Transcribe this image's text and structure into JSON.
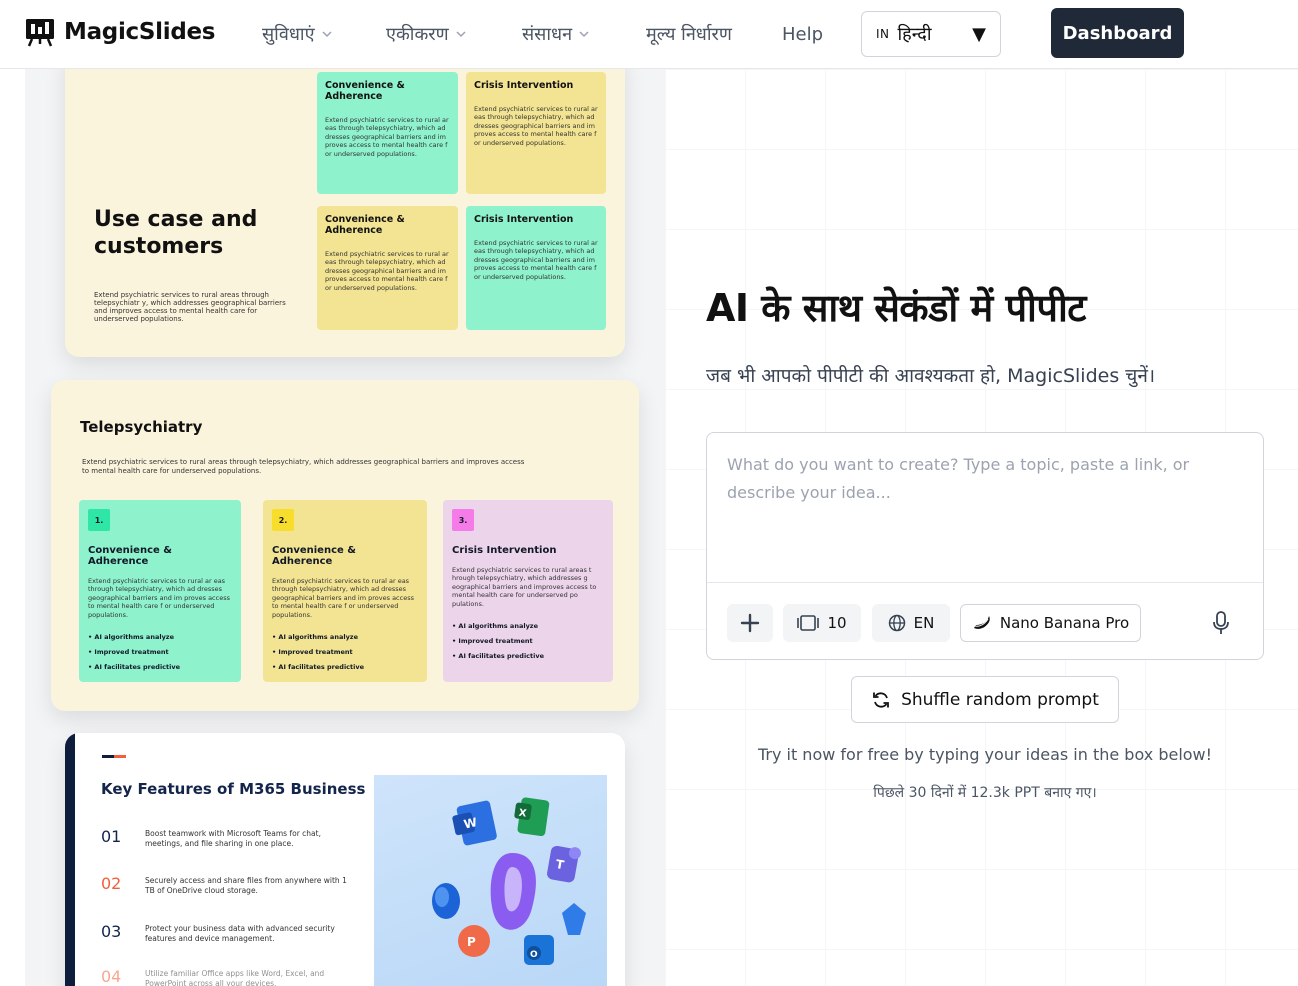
{
  "nav": {
    "logo_text": "MagicSlides",
    "items": [
      {
        "label": "सुविधाएं",
        "has_dropdown": true
      },
      {
        "label": "एकीकरण",
        "has_dropdown": true
      },
      {
        "label": "संसाधन",
        "has_dropdown": true
      },
      {
        "label": "मूल्य निर्धारण",
        "has_dropdown": false
      },
      {
        "label": "Help",
        "has_dropdown": false
      }
    ],
    "language": {
      "code": "IN",
      "label": "हिन्दी"
    },
    "dashboard_label": "Dashboard"
  },
  "slides": {
    "s1": {
      "title": "Use case and customers",
      "desc": "Extend psychiatric services to rural areas through telepsychiatr y, which addresses geographical barriers and improves access to mental health care for underserved populations.",
      "cards": [
        {
          "title": "Convenience & Adherence",
          "text": "Extend psychiatric services to rural ar eas through telepsychiatry, which ad dresses geographical barriers and im proves access to mental health care f or underserved populations.",
          "color": "#8ef2cd"
        },
        {
          "title": "Crisis Intervention",
          "text": "Extend psychiatric services to rural ar eas through telepsychiatry, which ad dresses geographical barriers and im proves access to mental health care f or underserved populations.",
          "color": "#f2e492"
        },
        {
          "title": "Convenience & Adherence",
          "text": "Extend psychiatric services to rural ar eas through telepsychiatry, which ad dresses geographical barriers and im proves access to mental health care f or underserved populations.",
          "color": "#f2e492"
        },
        {
          "title": "Crisis Intervention",
          "text": "Extend psychiatric services to rural ar eas through telepsychiatry, which ad dresses geographical barriers and im proves access to mental health care f or underserved populations.",
          "color": "#8ef2cd"
        }
      ]
    },
    "s2": {
      "title": "Telepsychiatry",
      "desc": "Extend psychiatric services to rural areas through telepsychiatry, which addresses geographical barriers and improves access to mental health care for underserved populations.",
      "columns": [
        {
          "num": "1.",
          "title": "Convenience & Adherence",
          "text": "Extend psychiatric services to rural ar eas through telepsychiatry, which ad dresses geographical barriers and im proves access to mental health care f or underserved populations.",
          "bullets": [
            "• AI algorithms analyze",
            "• Improved treatment",
            "• AI facilitates predictive"
          ]
        },
        {
          "num": "2.",
          "title": "Convenience & Adherence",
          "text": "Extend psychiatric services to rural ar eas through telepsychiatry, which ad dresses geographical barriers and im proves access to mental health care f or underserved populations.",
          "bullets": [
            "• AI algorithms analyze",
            "• Improved treatment",
            "• AI facilitates predictive"
          ]
        },
        {
          "num": "3.",
          "title": "Crisis Intervention",
          "text": "Extend psychiatric services to rural areas t hrough telepsychiatry, which addresses g eographical barriers and improves access to mental health care for underserved po pulations.",
          "bullets": [
            "• AI algorithms analyze",
            "• Improved treatment",
            "• AI facilitates predictive"
          ]
        }
      ]
    },
    "s3": {
      "title": "Key Features of M365 Business",
      "features": [
        {
          "num": "01",
          "text": "Boost teamwork with Microsoft Teams for chat, meetings, and file sharing in one place."
        },
        {
          "num": "02",
          "text": "Securely access and share files from anywhere with 1 TB of OneDrive cloud storage."
        },
        {
          "num": "03",
          "text": "Protect your business data with advanced security features and device management."
        },
        {
          "num": "04",
          "text": "Utilize familiar Office apps like Word, Excel, and PowerPoint across all your devices."
        }
      ]
    }
  },
  "hero": {
    "title": "AI के साथ सेकंडों में पीपीट",
    "subtitle": "जब भी आपको पीपीटी की आवश्यकता हो, MagicSlides चुनें।"
  },
  "prompt": {
    "placeholder": "What do you want to create? Type a topic, paste a link, or describe your idea...",
    "slide_count": "10",
    "language": "EN",
    "model": "Nano Banana Pro"
  },
  "shuffle_label": "Shuffle random prompt",
  "try_text": "Try it now for free by typing your ideas in the box below!",
  "count_text": "पिछले 30 दिनों में 12.3k PPT बनाए गए।"
}
